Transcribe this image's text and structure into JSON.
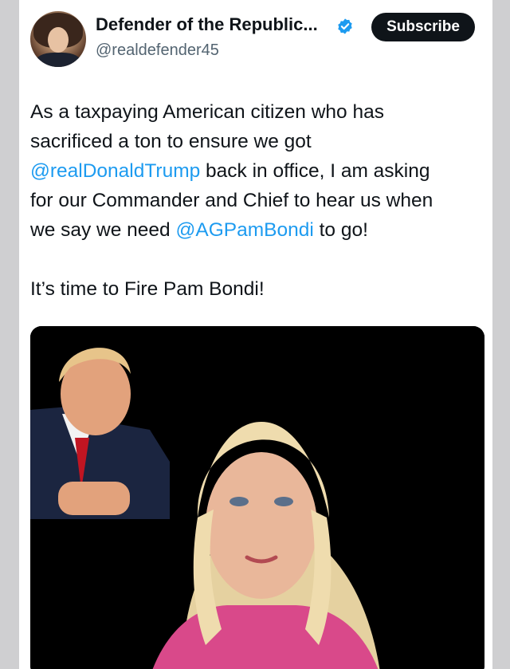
{
  "post": {
    "author_name": "Defender of the Republic...",
    "author_handle": "@realdefender45",
    "subscribe_label": "Subscribe",
    "text_line1_a": "As a taxpaying American citizen who has",
    "text_line2_a": "sacrificed a ton to ensure we got",
    "mention_trump": "@realDonaldTrump",
    "text_line3_b": " back in office, I am asking",
    "text_line4_a": "for our Commander and Chief to hear us when",
    "text_line5_a": "we say we need ",
    "mention_bondi": "@AGPamBondi",
    "text_line5_b": " to go!",
    "text_line6": "It’s time to Fire Pam Bondi!"
  },
  "colors": {
    "mention": "#1d9bf0",
    "verified": "#1d9bf0",
    "button": "#0f1419"
  },
  "icons": {
    "verified": "verified-badge-icon"
  }
}
